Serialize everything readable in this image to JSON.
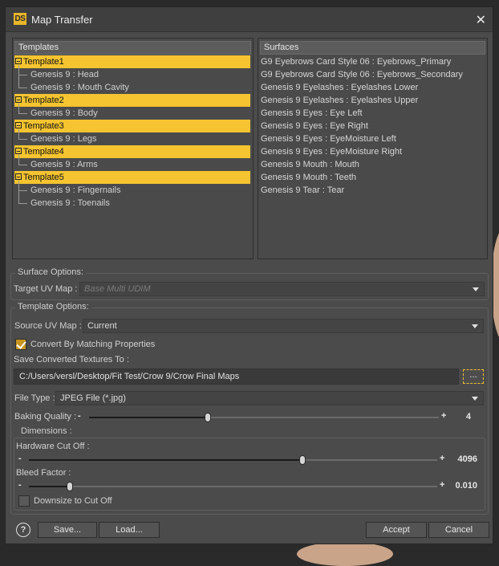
{
  "window": {
    "icon_text": "DS",
    "title": "Map Transfer",
    "close_glyph": "✕"
  },
  "templates_panel": {
    "header": "Templates",
    "groups": [
      {
        "name": "Template1",
        "children": [
          "Genesis 9 : Head",
          "Genesis 9 : Mouth Cavity"
        ]
      },
      {
        "name": "Template2",
        "children": [
          "Genesis 9 : Body"
        ]
      },
      {
        "name": "Template3",
        "children": [
          "Genesis 9 : Legs"
        ]
      },
      {
        "name": "Template4",
        "children": [
          "Genesis 9 : Arms"
        ]
      },
      {
        "name": "Template5",
        "children": [
          "Genesis 9 : Fingernails",
          "Genesis 9 : Toenails"
        ]
      }
    ]
  },
  "surfaces_panel": {
    "header": "Surfaces",
    "items": [
      "G9 Eyebrows Card Style 06 : Eyebrows_Primary",
      "G9 Eyebrows Card Style 06 : Eyebrows_Secondary",
      "Genesis 9 Eyelashes : Eyelashes Lower",
      "Genesis 9 Eyelashes : Eyelashes Upper",
      "Genesis 9 Eyes : Eye Left",
      "Genesis 9 Eyes : Eye Right",
      "Genesis 9 Eyes : EyeMoisture Left",
      "Genesis 9 Eyes : EyeMoisture Right",
      "Genesis 9 Mouth : Mouth",
      "Genesis 9 Mouth : Teeth",
      "Genesis 9 Tear : Tear"
    ]
  },
  "surface_options": {
    "title": "Surface Options:",
    "target_uv_label": "Target UV Map :",
    "target_uv_value": "Base Multi UDIM"
  },
  "template_options": {
    "title": "Template Options:",
    "source_uv_label": "Source UV Map :",
    "source_uv_value": "Current",
    "convert_label": "Convert By Matching Properties",
    "convert_checked": true,
    "save_to_label": "Save Converted Textures To :",
    "save_path": "C:/Users/versl/Desktop/Fit Test/Crow 9/Crow Final Maps",
    "browse_label": "...",
    "file_type_label": "File Type :",
    "file_type_value": "JPEG File (*.jpg)",
    "baking_quality_label": "Baking Quality :",
    "baking_quality_value": "4",
    "baking_quality_fraction": 0.34
  },
  "dimensions": {
    "title": "Dimensions :",
    "hardware_cutoff_label": "Hardware Cut Off :",
    "hardware_cutoff_value": "4096",
    "hardware_cutoff_fraction": 0.67,
    "bleed_factor_label": "Bleed Factor :",
    "bleed_factor_value": "0.010",
    "bleed_factor_fraction": 0.1,
    "downsize_label": "Downsize to Cut Off",
    "downsize_checked": false
  },
  "footer": {
    "help_glyph": "?",
    "save_label": "Save...",
    "load_label": "Load...",
    "accept_label": "Accept",
    "cancel_label": "Cancel"
  },
  "slider_glyphs": {
    "minus": "-",
    "plus": "+"
  },
  "colors": {
    "accent": "#f5c430",
    "dialog_bg": "#4b4b4b"
  }
}
